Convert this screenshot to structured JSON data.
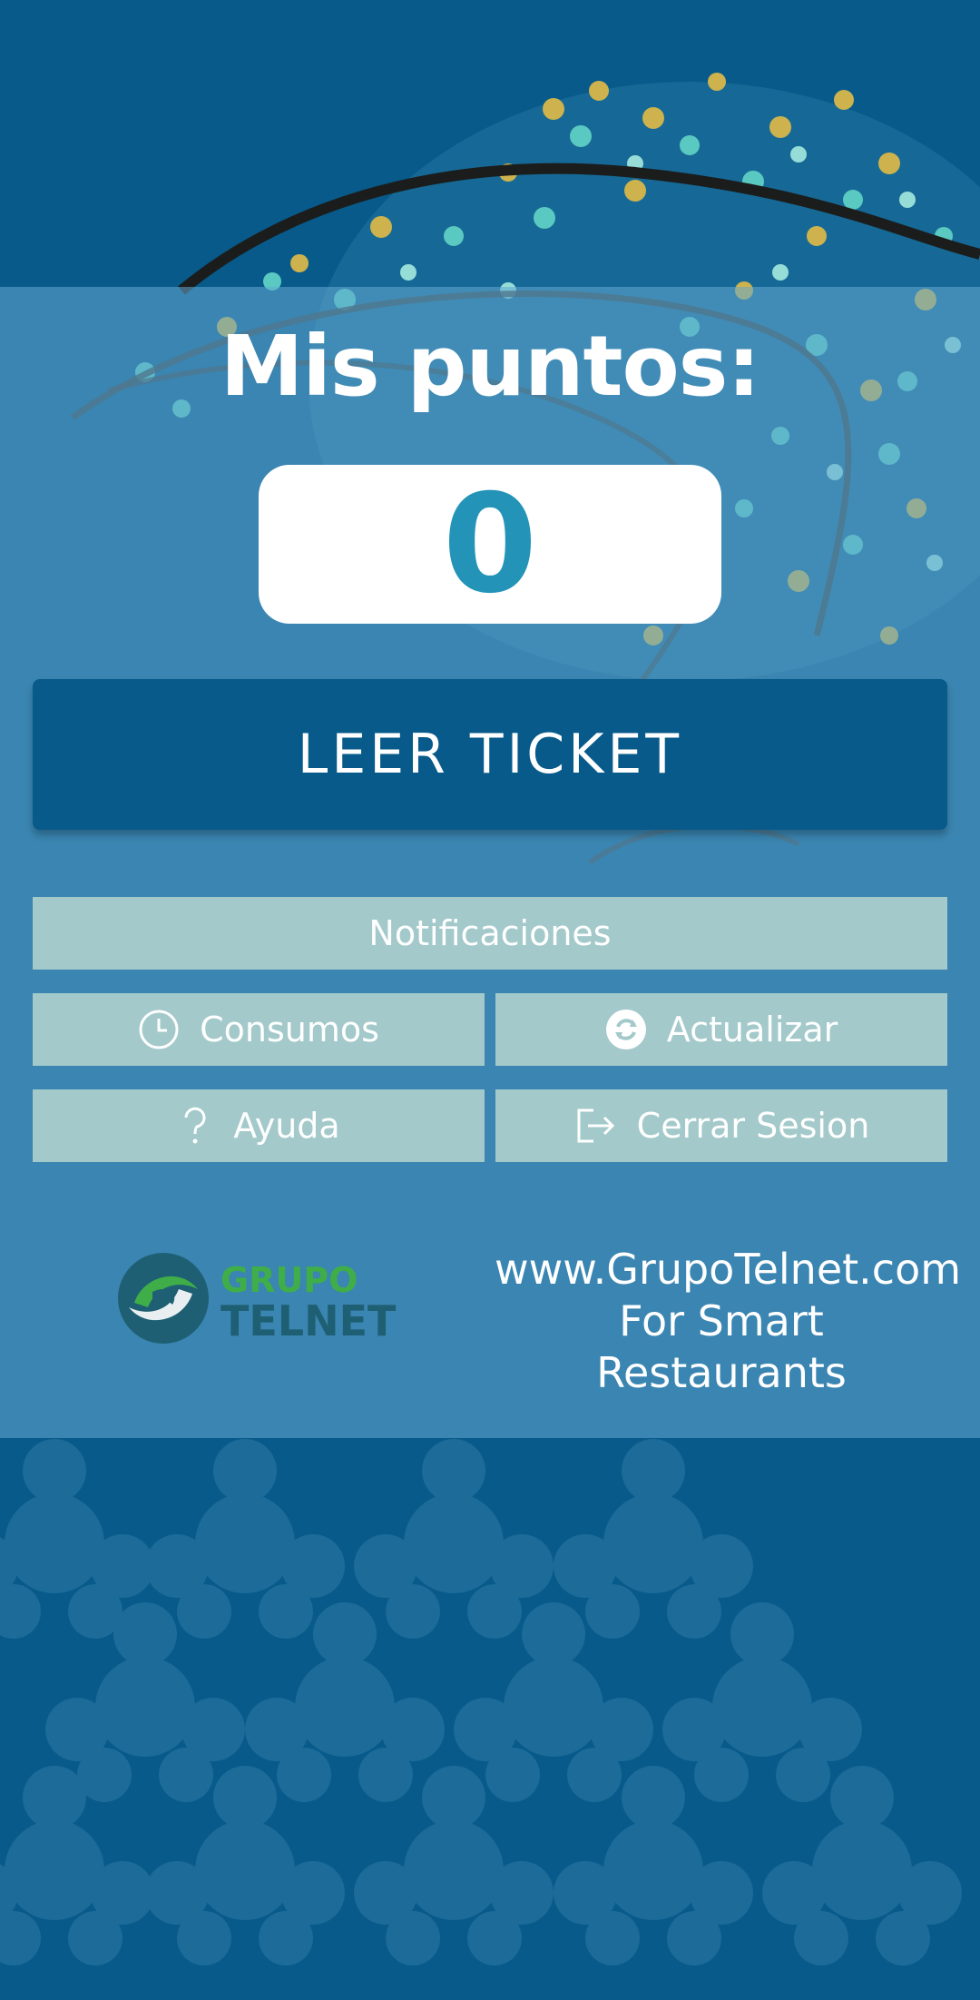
{
  "header": {
    "title": "Mis puntos:"
  },
  "points": {
    "value": "0"
  },
  "actions": {
    "read_ticket": "LEER TICKET",
    "notifications": "Notificaciones",
    "consumption": "Consumos",
    "refresh": "Actualizar",
    "help": "Ayuda",
    "logout": "Cerrar Sesion"
  },
  "icons": {
    "consumption": "clock-icon",
    "refresh": "refresh-icon",
    "help": "question-icon",
    "logout": "logout-icon"
  },
  "footer": {
    "logo_line1": "GRUPO",
    "logo_line2": "TELNET",
    "website": "www.GrupoTelnet.com",
    "tagline_line1": "For Smart",
    "tagline_line2": "Restaurants"
  },
  "colors": {
    "background": "#075a8a",
    "panel": "#64aad2",
    "button_light": "#a3c9ca",
    "points_text": "#2394b8",
    "logo_green": "#3fae49",
    "logo_dark": "#1e5f73"
  }
}
